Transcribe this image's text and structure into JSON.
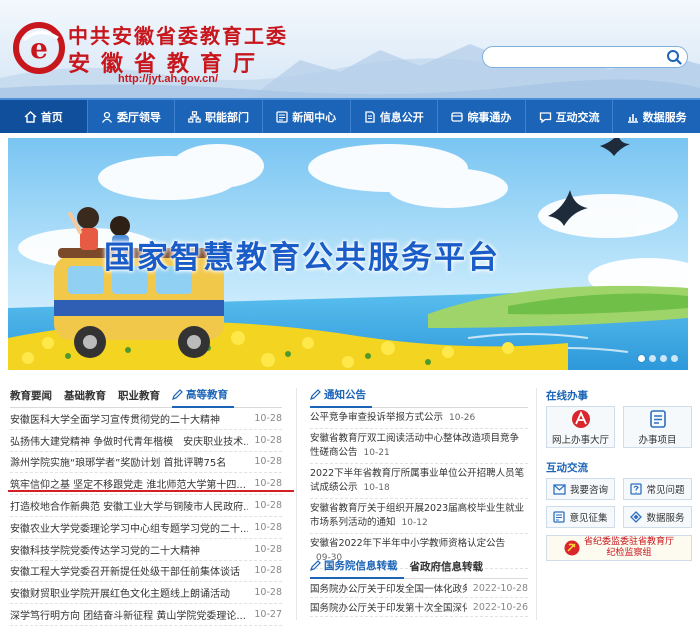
{
  "header": {
    "title_line1": "中共安徽省委教育工委",
    "title_line2": "安徽省教育厅",
    "url": "http://jyt.ah.gov.cn/",
    "search_placeholder": "",
    "colors": {
      "brand_red": "#c8161d",
      "nav_blue": "#1b64b8"
    }
  },
  "nav": {
    "items": [
      {
        "label": "首页",
        "icon": "home-icon"
      },
      {
        "label": "委厅领导",
        "icon": "user-icon"
      },
      {
        "label": "职能部门",
        "icon": "org-icon"
      },
      {
        "label": "新闻中心",
        "icon": "news-icon"
      },
      {
        "label": "信息公开",
        "icon": "doc-icon"
      },
      {
        "label": "皖事通办",
        "icon": "service-icon"
      },
      {
        "label": "互动交流",
        "icon": "chat-icon"
      },
      {
        "label": "数据服务",
        "icon": "chart-icon"
      }
    ]
  },
  "banner": {
    "title": "国家智慧教育公共服务平台",
    "slide_count": 4
  },
  "left": {
    "tabs": [
      "教育要闻",
      "基础教育",
      "职业教育",
      "高等教育"
    ],
    "items": [
      {
        "title": "安徽医科大学全面学习宣传贯彻党的二十大精神",
        "date": "10-28"
      },
      {
        "title": "弘扬伟大建党精神 争做时代青年楷模　安庆职业技术...",
        "date": "10-28"
      },
      {
        "title": "滁州学院实施“琅琊学者”奖励计划 首批评聘75名",
        "date": "10-28"
      },
      {
        "title": "筑牢信仰之基 坚定不移跟党走 淮北师范大学第十四...",
        "date": "10-28"
      },
      {
        "title": "打造校地合作新典范 安徽工业大学与铜陵市人民政府...",
        "date": "10-28"
      },
      {
        "title": "安徽农业大学党委理论学习中心组专题学习党的二十...",
        "date": "10-28"
      },
      {
        "title": "安徽科技学院党委传达学习党的二十大精神",
        "date": "10-28"
      },
      {
        "title": "安徽工程大学党委召开新提任处级干部任前集体谈话",
        "date": "10-28"
      },
      {
        "title": "安徽财贸职业学院开展红色文化主题线上朗诵活动",
        "date": "10-28"
      },
      {
        "title": "深学笃行明方向 团结奋斗新征程 黄山学院党委理论...",
        "date": "10-27"
      }
    ]
  },
  "middle": {
    "tab": "通知公告",
    "items": [
      {
        "title": "公平竞争审查投诉举报方式公示",
        "date": "10-26"
      },
      {
        "title": "安徽省教育厅双工阅读活动中心整体改造项目竞争性磋商公告",
        "date": "10-21"
      },
      {
        "title": "2022下半年省教育厅所属事业单位公开招聘人员笔试成绩公示",
        "date": "10-18"
      },
      {
        "title": "安徽省教育厅关于组织开展2023届高校毕业生就业市场系列活动的通知",
        "date": "10-12"
      },
      {
        "title": "安徽省2022年下半年中小学教师资格认定公告",
        "date": "09-30"
      }
    ],
    "tabs2": [
      "国务院信息转载",
      "省政府信息转载"
    ],
    "items2": [
      {
        "title": "国务院办公厅关于印发全国一体化政务大数...",
        "date": "2022-10-28"
      },
      {
        "title": "国务院办公厅关于印发第十次全国深化“放...",
        "date": "2022-10-26"
      }
    ]
  },
  "right": {
    "online_title": "在线办事",
    "online": [
      {
        "label": "网上办事大厅",
        "icon": "hall-icon"
      },
      {
        "label": "办事项目",
        "icon": "list-icon"
      }
    ],
    "interact_title": "互动交流",
    "interact": [
      {
        "label": "我要咨询",
        "icon": "mail-icon"
      },
      {
        "label": "常见问题",
        "icon": "question-icon"
      },
      {
        "label": "意见征集",
        "icon": "collect-icon"
      },
      {
        "label": "数据服务",
        "icon": "data-icon"
      }
    ],
    "jiwei_line1": "省纪委监委驻省教育厅",
    "jiwei_line2": "纪检监察组"
  }
}
